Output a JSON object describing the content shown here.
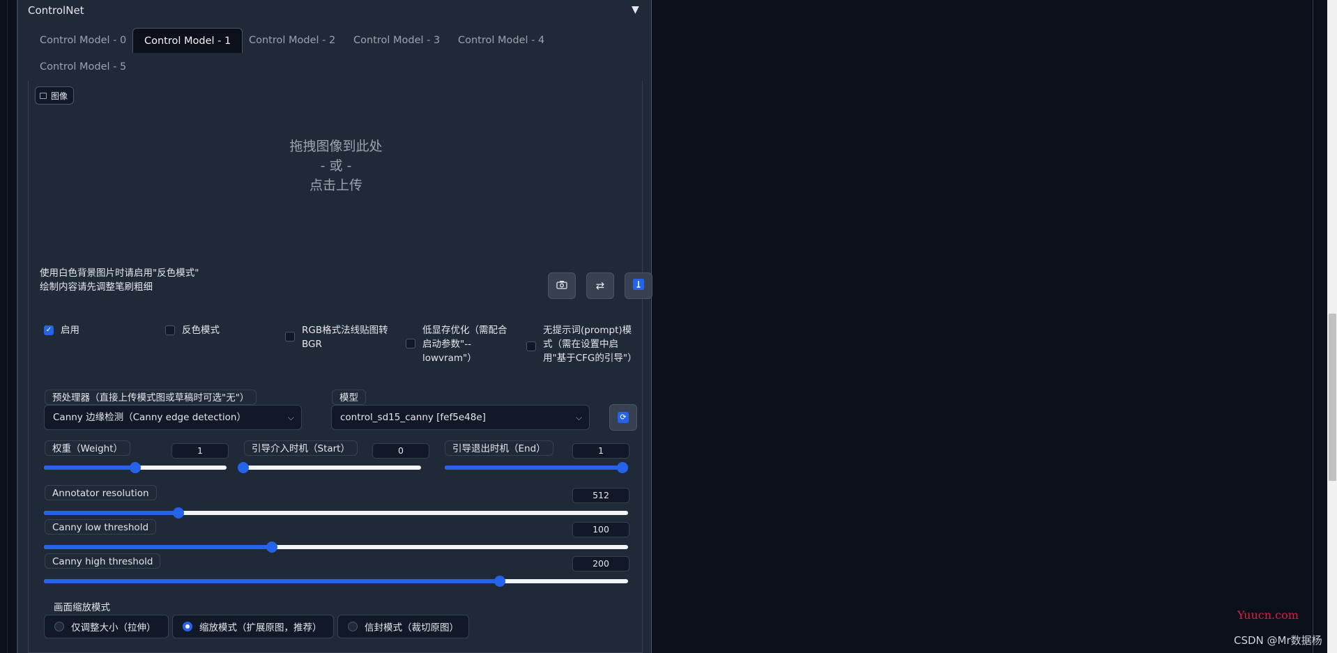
{
  "accordion": {
    "title": "ControlNet",
    "toggle_glyph": "▼"
  },
  "tabs": [
    {
      "label": "Control Model - 0"
    },
    {
      "label": "Control Model - 1"
    },
    {
      "label": "Control Model - 2"
    },
    {
      "label": "Control Model - 3"
    },
    {
      "label": "Control Model - 4"
    },
    {
      "label": "Control Model - 5"
    }
  ],
  "active_tab": 1,
  "image": {
    "label": "图像",
    "drop_line1": "拖拽图像到此处",
    "drop_line2": "- 或 -",
    "drop_line3": "点击上传",
    "hint_line1": "使用白色背景图片时请启用\"反色模式\"",
    "hint_line2": "绘制内容请先调整笔刷粗细",
    "tools": [
      {
        "icon": "camera-icon",
        "glyph": "📷"
      },
      {
        "icon": "swap-icon",
        "glyph": "⇄"
      },
      {
        "icon": "brush-size-icon",
        "glyph": "⤴"
      }
    ]
  },
  "checkboxes": [
    {
      "label": "启用",
      "checked": true
    },
    {
      "label": "反色模式",
      "checked": false
    },
    {
      "label": "RGB格式法线贴图转BGR",
      "checked": false
    },
    {
      "label": "低显存优化（需配合启动参数\"--lowvram\"）",
      "checked": false
    },
    {
      "label": "无提示词(prompt)模式（需在设置中启用\"基于CFG的引导\"）",
      "checked": false
    }
  ],
  "preprocessor": {
    "label": "预处理器（直接上传模式图或草稿时可选\"无\"）",
    "value": "Canny 边缘检测（Canny edge detection）"
  },
  "model": {
    "label": "模型",
    "value": "control_sd15_canny [fef5e48e]"
  },
  "weight": {
    "label": "权重（Weight）",
    "value": "1",
    "fraction": 0.5
  },
  "guidance_start": {
    "label": "引导介入时机（Start）",
    "value": "0",
    "fraction": 0.0
  },
  "guidance_end": {
    "label": "引导退出时机（End）",
    "value": "1",
    "fraction": 1.0
  },
  "annotator_resolution": {
    "label": "Annotator resolution",
    "value": "512",
    "fraction": 0.23
  },
  "canny_low": {
    "label": "Canny low threshold",
    "value": "100",
    "fraction": 0.39
  },
  "canny_high": {
    "label": "Canny high threshold",
    "value": "200",
    "fraction": 0.78
  },
  "resize_mode": {
    "label": "画面缩放模式",
    "options": [
      {
        "label": "仅调整大小（拉伸）",
        "selected": false
      },
      {
        "label": "缩放模式（扩展原图，推荐）",
        "selected": true
      },
      {
        "label": "信封模式（裁切原图）",
        "selected": false
      }
    ]
  },
  "watermark": {
    "site": "Yuucn.com",
    "author": "CSDN @Mr数据杨"
  },
  "colors": {
    "accent": "#2563eb",
    "panel": "#1f2937",
    "background": "#0b0f19"
  }
}
